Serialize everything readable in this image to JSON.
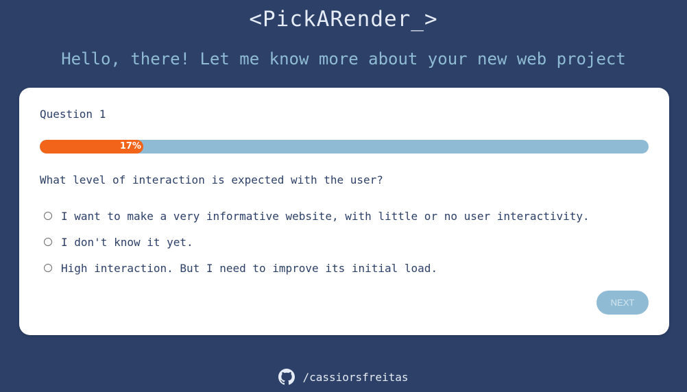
{
  "header": {
    "title": "<PickARender_>",
    "subtitle": "Hello, there! Let me know more about your new web project"
  },
  "quiz": {
    "question_number": "Question 1",
    "progress_label": "17%",
    "progress_percent": 17,
    "question": "What level of interaction is expected with the user?",
    "options": [
      "I want to make a very informative website, with little or no user interactivity.",
      "I don't know it yet.",
      "High interaction. But I need to improve its initial load."
    ],
    "next_label": "NEXT"
  },
  "footer": {
    "icon": "github-icon",
    "link_text": "/cassiorsfreitas"
  },
  "colors": {
    "background": "#2d4068",
    "accent": "#f26419",
    "track": "#8fbcd4",
    "card": "#ffffff"
  }
}
